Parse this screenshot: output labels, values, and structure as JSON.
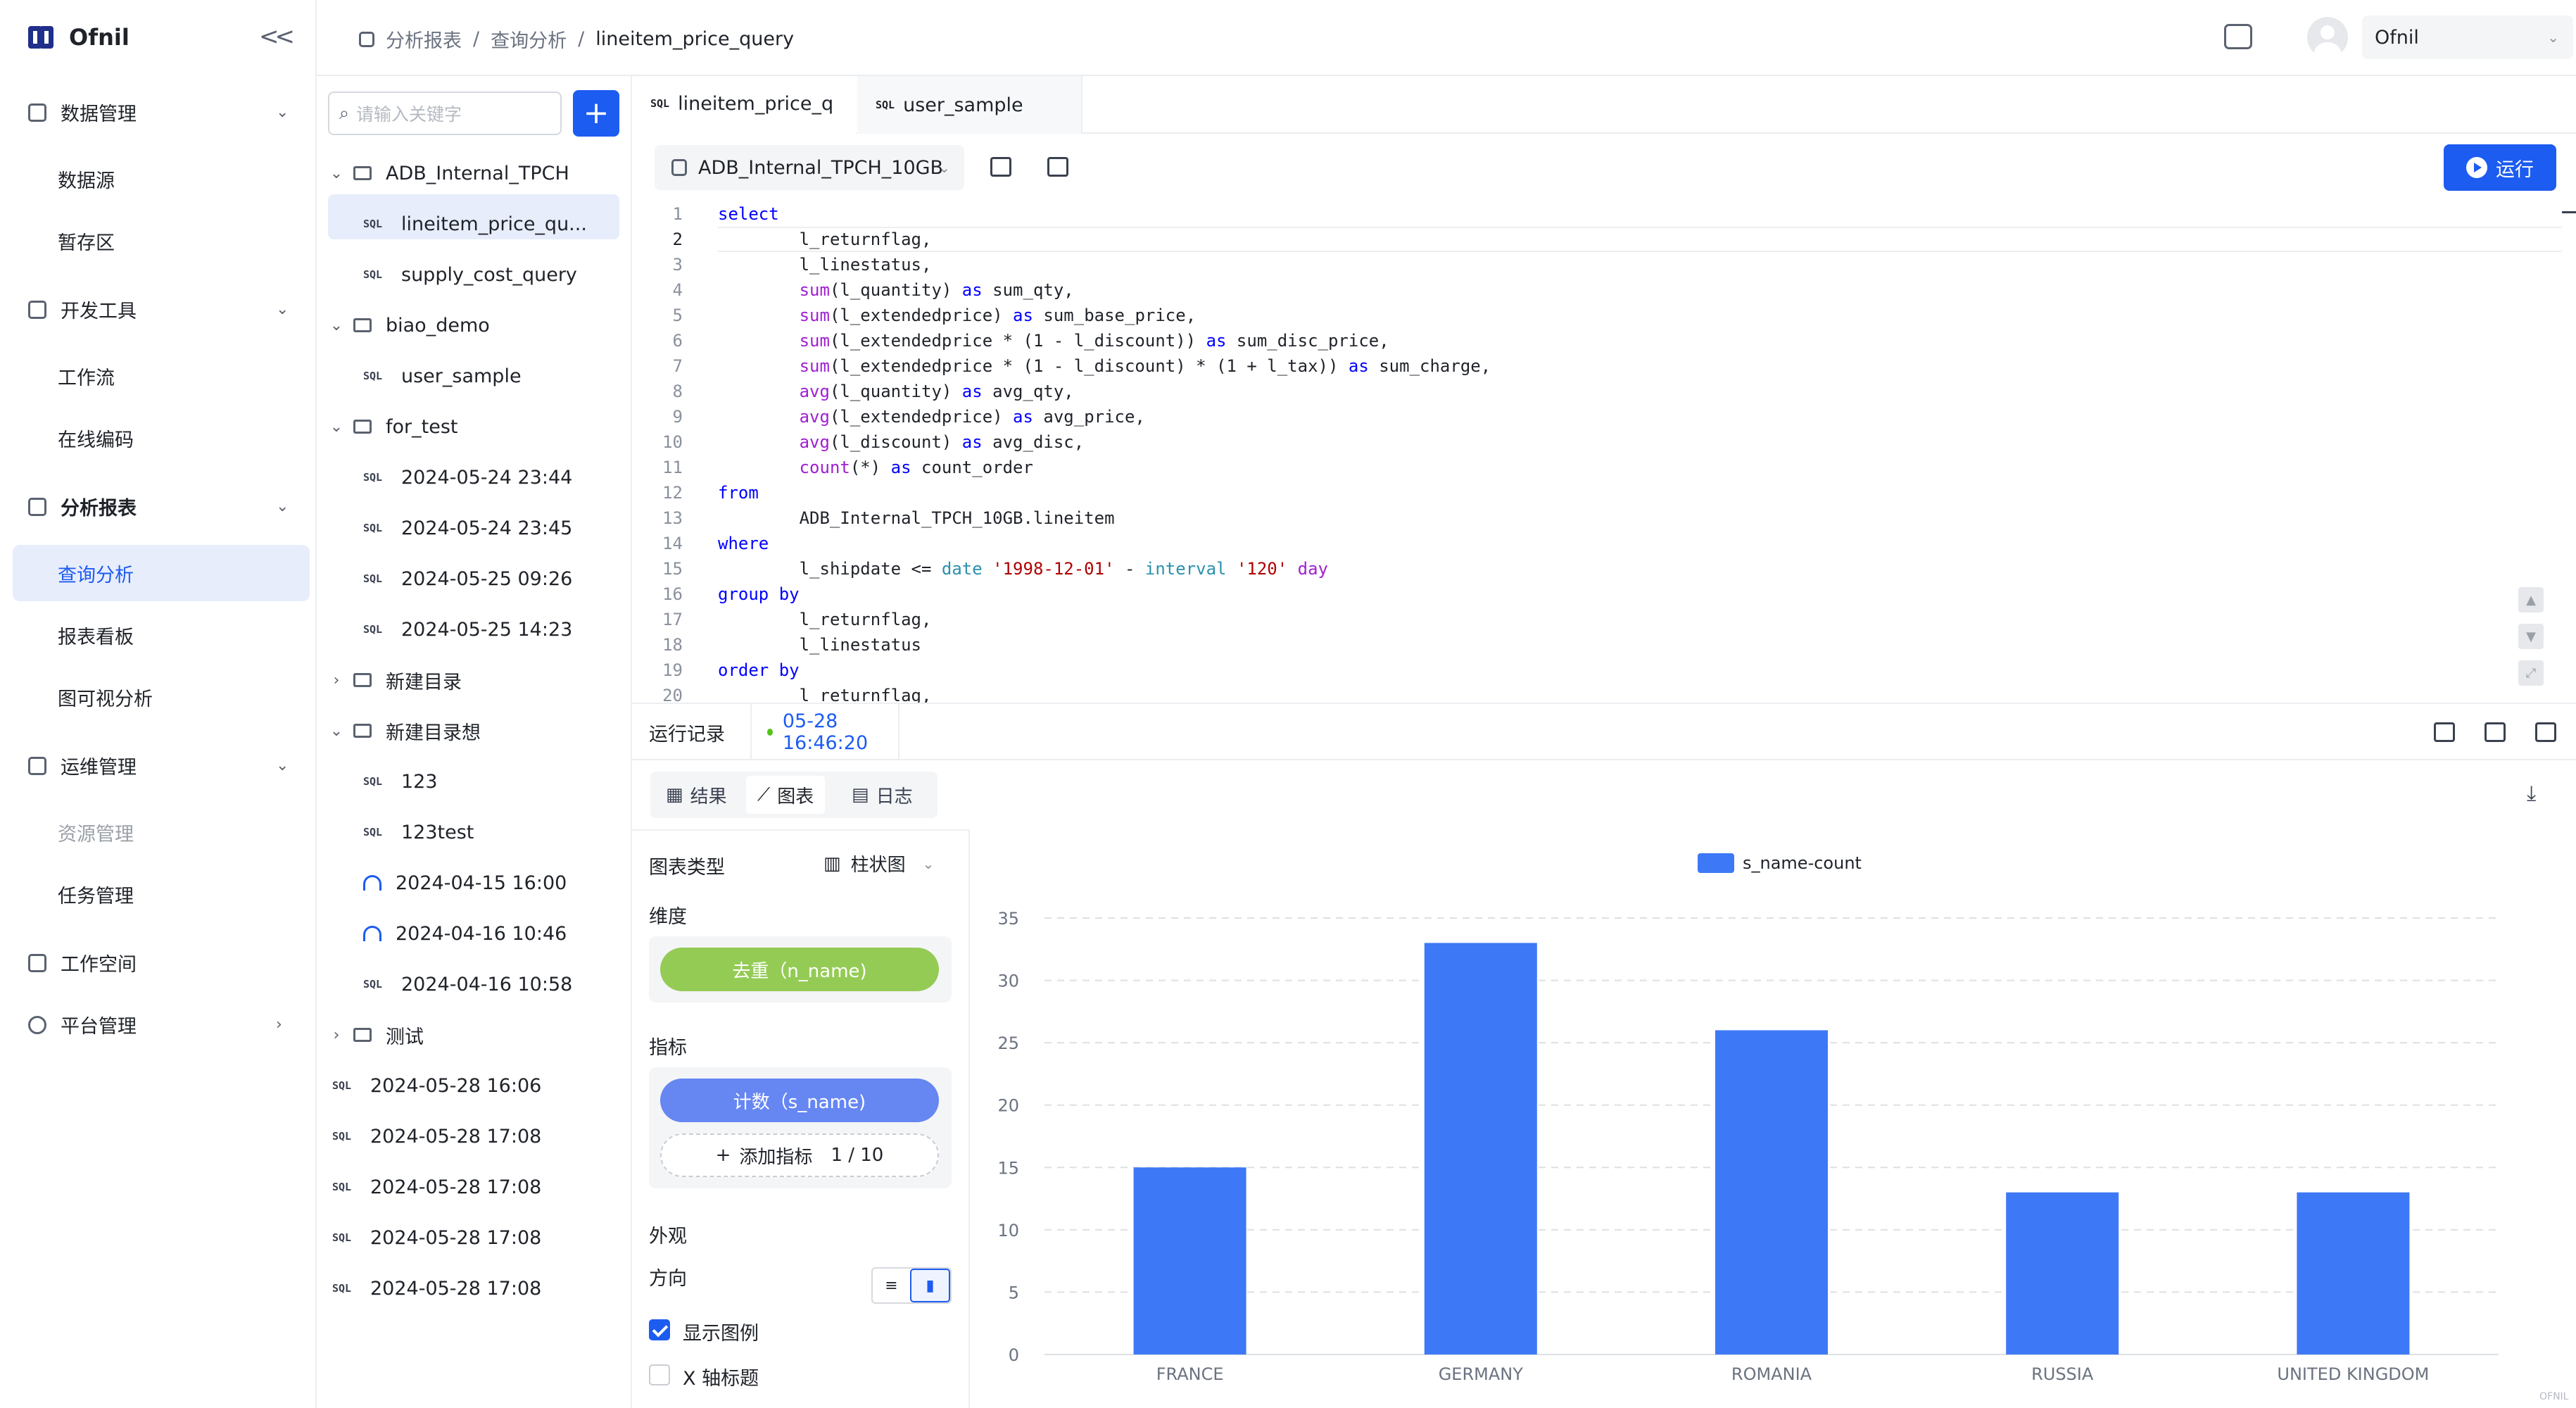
{
  "app": {
    "name": "Ofnil"
  },
  "nav": {
    "groups": [
      {
        "label": "数据管理",
        "items": [
          "数据源",
          "暂存区"
        ]
      },
      {
        "label": "开发工具",
        "items": [
          "工作流",
          "在线编码"
        ]
      },
      {
        "label": "分析报表",
        "items": [
          "查询分析",
          "报表看板",
          "图可视分析"
        ]
      },
      {
        "label": "运维管理",
        "items": [
          "资源管理",
          "任务管理"
        ]
      },
      {
        "label": "工作空间",
        "items": []
      },
      {
        "label": "平台管理",
        "items": []
      }
    ],
    "active_item": "查询分析",
    "disabled_item": "资源管理"
  },
  "header": {
    "breadcrumb": [
      "分析报表",
      "查询分析",
      "lineitem_price_query"
    ],
    "user": "Ofnil"
  },
  "tree": {
    "search_placeholder": "请输入关键字",
    "add_label": "+",
    "rows": [
      {
        "type": "folder",
        "label": "ADB_Internal_TPCH",
        "open": true
      },
      {
        "type": "sql",
        "label": "lineitem_price_qu..."
      },
      {
        "type": "sql",
        "label": "supply_cost_query"
      },
      {
        "type": "folder",
        "label": "biao_demo",
        "open": true
      },
      {
        "type": "sql",
        "label": "user_sample"
      },
      {
        "type": "folder",
        "label": "for_test",
        "open": true
      },
      {
        "type": "sql",
        "label": "2024-05-24 23:44"
      },
      {
        "type": "sql",
        "label": "2024-05-24 23:45"
      },
      {
        "type": "sql",
        "label": "2024-05-25 09:26"
      },
      {
        "type": "sql",
        "label": "2024-05-25 14:23"
      },
      {
        "type": "folder",
        "label": "新建目录",
        "open": false
      },
      {
        "type": "folder",
        "label": "新建目录想",
        "open": true
      },
      {
        "type": "sql",
        "label": "123"
      },
      {
        "type": "sql",
        "label": "123test"
      },
      {
        "type": "flow",
        "label": "2024-04-15 16:00"
      },
      {
        "type": "flow",
        "label": "2024-04-16 10:46"
      },
      {
        "type": "sql",
        "label": "2024-04-16 10:58"
      },
      {
        "type": "folder",
        "label": "测试",
        "open": false
      },
      {
        "type": "sql",
        "label": "2024-05-28 16:06"
      },
      {
        "type": "sql",
        "label": "2024-05-28 17:08"
      },
      {
        "type": "sql",
        "label": "2024-05-28 17:08"
      },
      {
        "type": "sql",
        "label": "2024-05-28 17:08"
      },
      {
        "type": "sql",
        "label": "2024-05-28 17:08"
      }
    ]
  },
  "tabs": [
    {
      "label": "lineitem_price_q",
      "active": true,
      "badge": "SQL"
    },
    {
      "label": "user_sample",
      "active": false,
      "badge": "SQL"
    }
  ],
  "editor": {
    "datasource": "ADB_Internal_TPCH_10GB",
    "run_label": "运行",
    "lines": [
      "select",
      "        l_returnflag,",
      "        l_linestatus,",
      "        sum(l_quantity) as sum_qty,",
      "        sum(l_extendedprice) as sum_base_price,",
      "        sum(l_extendedprice * (1 - l_discount)) as sum_disc_price,",
      "        sum(l_extendedprice * (1 - l_discount) * (1 + l_tax)) as sum_charge,",
      "        avg(l_quantity) as avg_qty,",
      "        avg(l_extendedprice) as avg_price,",
      "        avg(l_discount) as avg_disc,",
      "        count(*) as count_order",
      "from",
      "        ADB_Internal_TPCH_10GB.lineitem",
      "where",
      "        l_shipdate <= date '1998-12-01' - interval '120' day",
      "group by",
      "        l_returnflag,",
      "        l_linestatus",
      "order by",
      "        l_returnflag,"
    ]
  },
  "result": {
    "history_label": "运行记录",
    "run_time": "05-28 16:46:20",
    "views": [
      "结果",
      "图表",
      "日志"
    ],
    "active_view": "图表"
  },
  "config": {
    "chart_type_label": "图表类型",
    "chart_type_value": "柱状图",
    "dimension_label": "维度",
    "dimension_pill": "去重（n_name)",
    "metric_label": "指标",
    "metric_pill": "计数（s_name)",
    "add_metric": "添加指标",
    "metric_count": "1 / 10",
    "appearance_label": "外观",
    "direction_label": "方向",
    "show_legend": "显示图例",
    "x_axis_title": "X 轴标题",
    "colors": {
      "dimension": "#94cb55",
      "metric": "#6686f2"
    }
  },
  "chart_data": {
    "type": "bar",
    "categories": [
      "FRANCE",
      "GERMANY",
      "ROMANIA",
      "RUSSIA",
      "UNITED KINGDOM"
    ],
    "series": [
      {
        "name": "s_name-count",
        "values": [
          15,
          33,
          26,
          13,
          13
        ],
        "color": "#3d78f6"
      }
    ],
    "ylim": [
      0,
      35
    ],
    "yticks": [
      0,
      5,
      10,
      15,
      20,
      25,
      30,
      35
    ],
    "grid": true,
    "legend": "top-center"
  },
  "footer": {
    "watermark": "OFNIL"
  }
}
